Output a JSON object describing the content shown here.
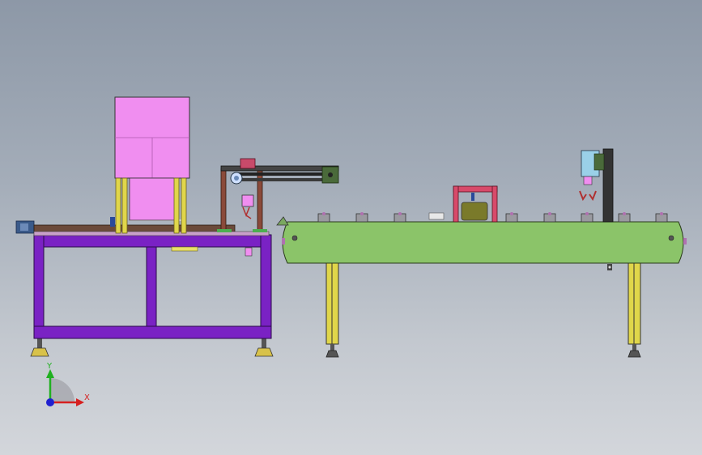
{
  "axes": {
    "x_label": "X",
    "y_label": "Y"
  },
  "colors": {
    "frame": "#7a22c4",
    "hopper": "#f08ef0",
    "conveyor": "#8bc469",
    "post": "#e0d64a",
    "gantry": "#8a4a3a",
    "foot": "#d8c24a",
    "x_axis": "#d62020",
    "y_axis": "#20b020",
    "z_axis": "#2020d0"
  }
}
